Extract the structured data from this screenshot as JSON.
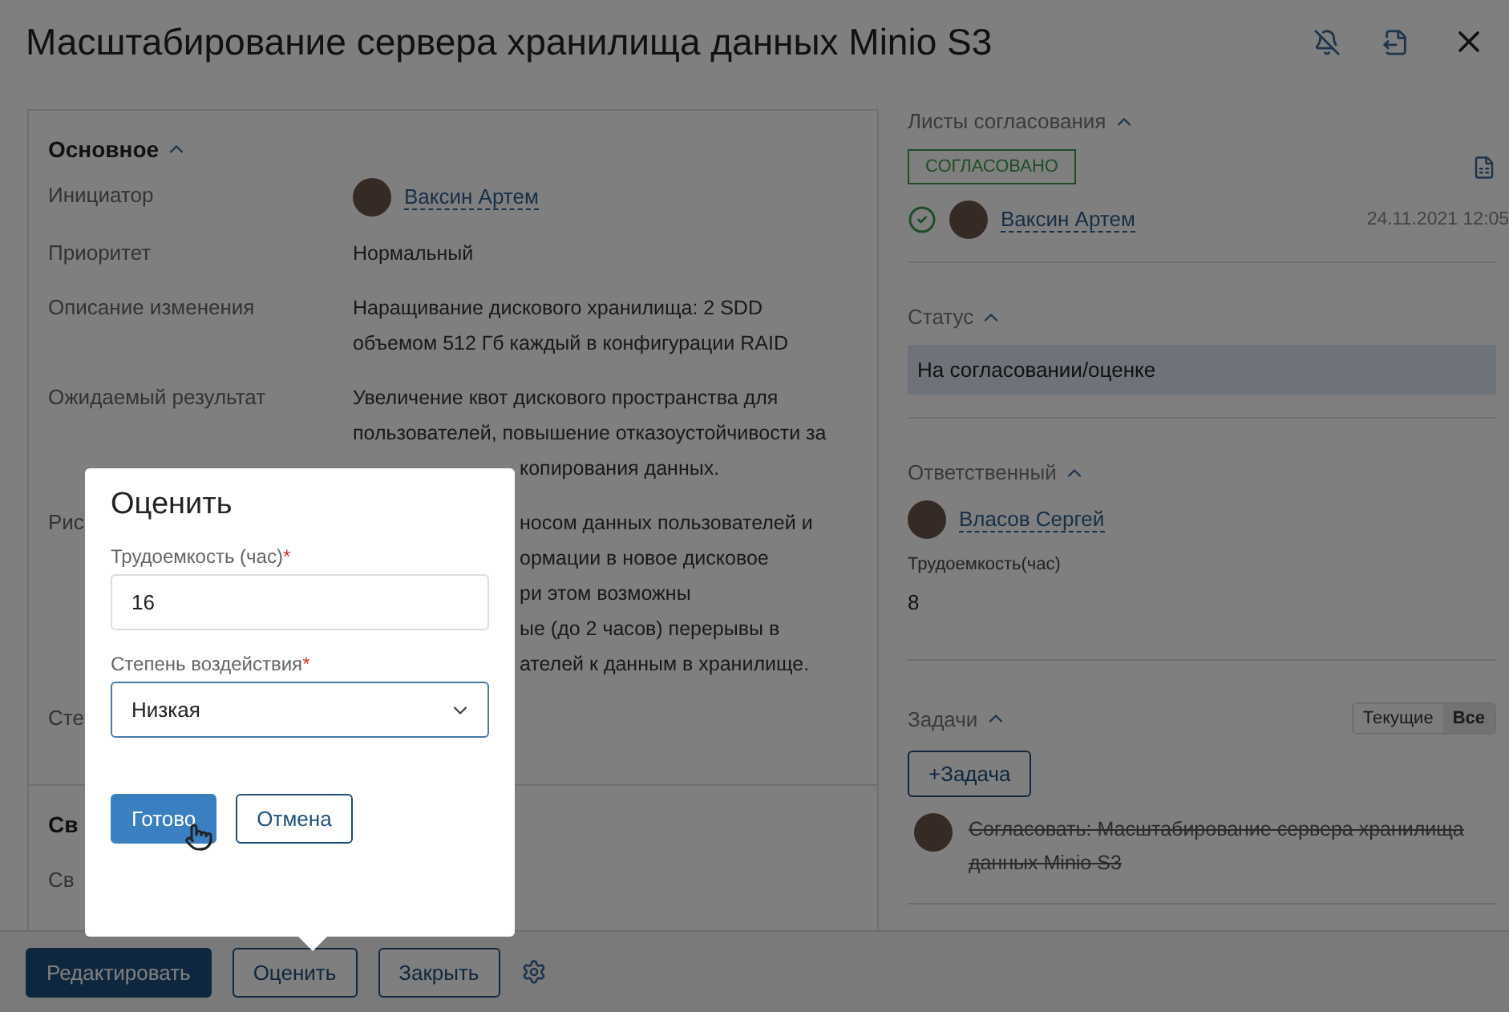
{
  "title": "Масштабирование сервера хранилища данных Minio S3",
  "main_section": {
    "title": "Основное",
    "expanded": true,
    "rows": [
      {
        "label": "Инициатор",
        "kind": "person",
        "value": "Ваксин Артем"
      },
      {
        "label": "Приоритет",
        "kind": "text",
        "lines": [
          "Нормальный"
        ]
      },
      {
        "label": "Описание изменения",
        "kind": "text",
        "lines": [
          "Наращивание дискового хранилища: 2 SDD",
          "объемом 512 Гб каждый в конфигурации RAID"
        ]
      },
      {
        "label": "Ожидаемый результат",
        "kind": "text",
        "lines": [
          "Увеличение квот дискового пространства для",
          "пользователей, повышение отказоустойчивости за",
          "копирования данных."
        ]
      },
      {
        "label": "Рис",
        "kind": "text",
        "lines": [
          "носом данных пользователей и",
          "ормации в новое дисковое",
          "ри этом возможны",
          "ые (до 2 часов) перерывы в",
          "ателей к данным в хранилище."
        ]
      },
      {
        "label": "Сте",
        "kind": "text",
        "lines": []
      }
    ]
  },
  "second_section": {
    "title": "Св",
    "rows": [
      {
        "label": "Св"
      }
    ]
  },
  "approval": {
    "title": "Листы согласования",
    "badge": "СОГЛАСОВАНО",
    "approver": "Ваксин Артем",
    "approved": true,
    "date": "24.11.2021 12:05"
  },
  "status": {
    "title": "Статус",
    "value": "На согласовании/оценке"
  },
  "responsible": {
    "title": "Ответственный",
    "person": "Власов Сергей",
    "effort_label": "Трудоемкость(час)",
    "effort_value": "8"
  },
  "tasks": {
    "title": "Задачи",
    "filters": [
      {
        "label": "Текущие",
        "selected": false
      },
      {
        "label": "Все",
        "selected": true
      }
    ],
    "add_button": "+Задача",
    "items": [
      {
        "text": "Согласовать: Масштабирование сервера хранилища данных Minio S3",
        "done": true
      }
    ]
  },
  "dialog": {
    "title": "Оценить",
    "fields": [
      {
        "kind": "input",
        "label": "Трудоемкость (час)",
        "required_mark": "*",
        "value": "16"
      },
      {
        "kind": "select",
        "label": "Степень воздействия",
        "required_mark": "*",
        "value": "Низкая",
        "focused": true
      }
    ],
    "buttons": [
      {
        "label": "Готово",
        "primary": true
      },
      {
        "label": "Отмена",
        "primary": false
      }
    ]
  },
  "footer": {
    "buttons": [
      {
        "label": "Редактировать",
        "primary": true
      },
      {
        "label": "Оценить",
        "primary": false
      },
      {
        "label": "Закрыть",
        "primary": false
      }
    ]
  }
}
